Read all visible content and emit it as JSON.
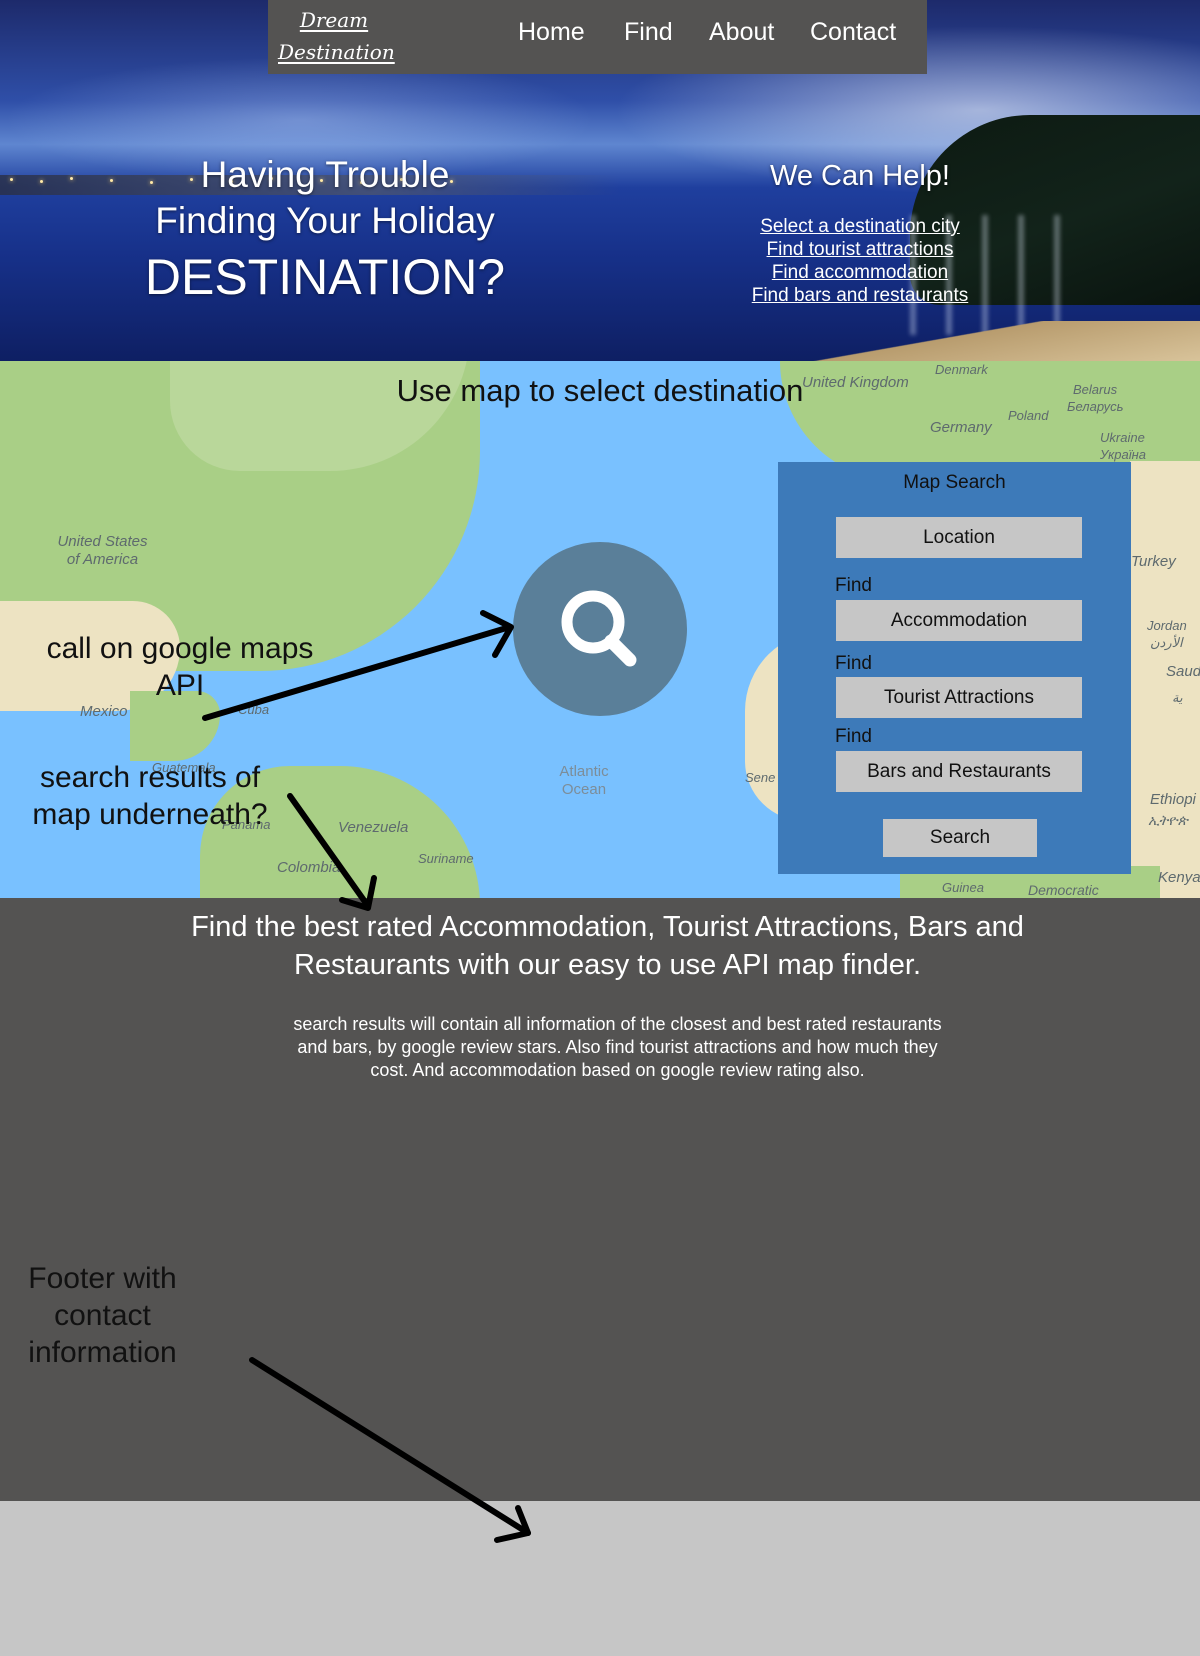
{
  "brand": {
    "logo_line1": "Dream",
    "logo_line2": "Destination"
  },
  "nav": {
    "home": "Home",
    "find": "Find",
    "about": "About",
    "contact": "Contact"
  },
  "hero": {
    "line1": "Having Trouble",
    "line2": "Finding Your Holiday",
    "line3": "DESTINATION?",
    "help_title": "We Can Help!",
    "links": [
      "Select a destination city",
      "Find tourist attractions",
      "Find accommodation",
      "Find bars and restaurants"
    ]
  },
  "map": {
    "heading": "Use map to select destination",
    "labels": {
      "usa": "United States of America",
      "mexico": "Mexico",
      "guatemala": "Guatemala",
      "venezuela": "Venezuela",
      "colombia": "Colombia",
      "suriname": "Suriname",
      "atlantic": "Atlantic Ocean",
      "uk": "United Kingdom",
      "denmark": "Denmark",
      "germany": "Germany",
      "poland": "Poland",
      "belarus": "Belarus",
      "belarus_local": "Беларусь",
      "ukraine": "Ukraine",
      "ukraine_local": "Україна",
      "turkey": "Turkey",
      "jordan": "Jordan",
      "jordan_local": "الأردن",
      "saudi": "Saud",
      "saudi_local": "ية",
      "ethiopia": "Ethiopi",
      "ethiopia_local": "ኢትዮጵ",
      "kenya": "Kenya",
      "senegal": "Sene",
      "guinea": "Guinea",
      "cuba": "Cuba",
      "panama": "Panama",
      "democratic": "Democratic"
    },
    "note_api": "call on google maps API",
    "note_results": "search results of map underneath?",
    "panel": {
      "title": "Map Search",
      "location": "Location",
      "find1": "Find",
      "accommodation": "Accommodation",
      "find2": "Find",
      "attractions": "Tourist Attractions",
      "find3": "Find",
      "bars": "Bars and Restaurants",
      "search": "Search"
    }
  },
  "info": {
    "headline": "Find the best rated Accommodation, Tourist Attractions, Bars and Restaurants with our easy to use API map finder.",
    "body": "search results will contain all information of the closest and best rated restaurants and bars, by google review stars. Also find tourist attractions and how much they cost. And accommodation based on google review rating also.",
    "footer_note": "Footer with contact information"
  },
  "colors": {
    "nav_bg": "#545352",
    "panel_bg": "#3d7ab9",
    "search_circle": "#5a7f99",
    "ocean": "#79c1ff",
    "info_bg": "#545352",
    "footer_bg": "#c6c6c6"
  },
  "icons": {
    "search": "magnifier-icon"
  }
}
